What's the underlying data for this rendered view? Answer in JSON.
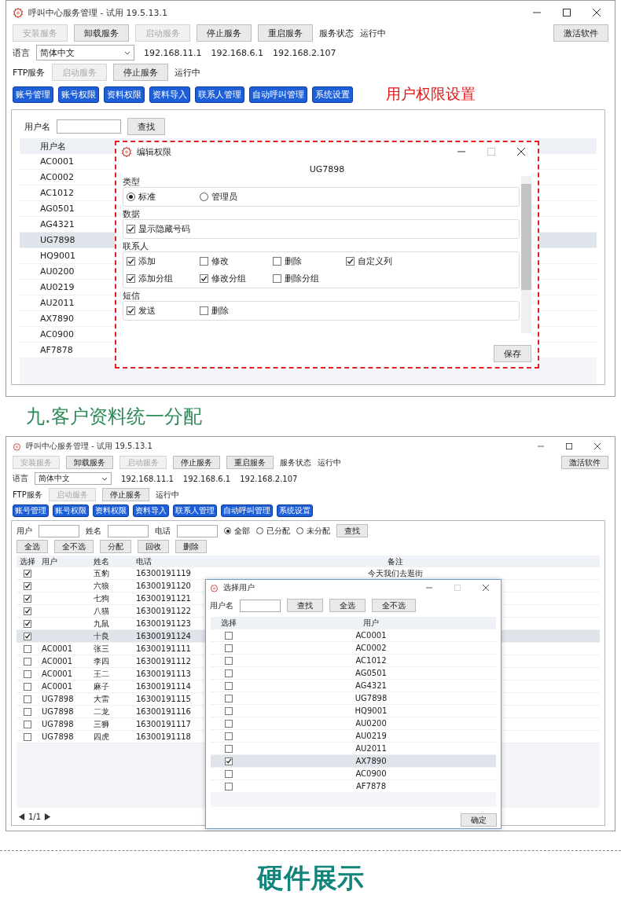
{
  "screen1": {
    "window": {
      "title": "呼叫中心服务管理 - 试用 19.5.13.1",
      "service_buttons": [
        {
          "label": "安装服务",
          "disabled": true
        },
        {
          "label": "卸载服务",
          "disabled": false
        },
        {
          "label": "启动服务",
          "disabled": true
        },
        {
          "label": "停止服务",
          "disabled": false
        },
        {
          "label": "重启服务",
          "disabled": false
        }
      ],
      "status_label": "服务状态",
      "status_value": "运行中",
      "activate_button": "激活软件",
      "language_label": "语言",
      "language_value": "简体中文",
      "ips": [
        "192.168.11.1",
        "192.168.6.1",
        "192.168.2.107"
      ],
      "ftp_label": "FTP服务",
      "ftp_buttons": [
        {
          "label": "启动服务",
          "disabled": true
        },
        {
          "label": "停止服务",
          "disabled": false
        }
      ],
      "ftp_status": "运行中",
      "nav_buttons": [
        "账号管理",
        "账号权限",
        "资料权限",
        "资料导入",
        "联系人管理",
        "自动呼叫管理",
        "系统设置"
      ]
    },
    "annotation": "用户权限设置",
    "search": {
      "label": "用户名",
      "button": "查找"
    },
    "table": {
      "columns": [
        "用户名"
      ],
      "rows": [
        {
          "user": "AC0001",
          "selected": false
        },
        {
          "user": "AC0002",
          "selected": false
        },
        {
          "user": "AC1012",
          "selected": false
        },
        {
          "user": "AG0501",
          "selected": false
        },
        {
          "user": "AG4321",
          "selected": false
        },
        {
          "user": "UG7898",
          "selected": true
        },
        {
          "user": "HQ9001",
          "selected": false
        },
        {
          "user": "AU0200",
          "selected": false
        },
        {
          "user": "AU0219",
          "selected": false
        },
        {
          "user": "AU2011",
          "selected": false
        },
        {
          "user": "AX7890",
          "selected": false
        },
        {
          "user": "AC0900",
          "selected": false
        },
        {
          "user": "AF7878",
          "selected": false
        }
      ]
    },
    "dialog": {
      "title": "编辑权限",
      "user": "UG7898",
      "groups": [
        {
          "title": "类型",
          "options": [
            {
              "kind": "radio",
              "label": "标准",
              "checked": true
            },
            {
              "kind": "radio",
              "label": "管理员",
              "checked": false
            }
          ]
        },
        {
          "title": "数据",
          "options": [
            {
              "kind": "checkbox",
              "label": "显示隐藏号码",
              "checked": true
            }
          ]
        },
        {
          "title": "联系人",
          "options": [
            {
              "kind": "checkbox",
              "label": "添加",
              "checked": true
            },
            {
              "kind": "checkbox",
              "label": "修改",
              "checked": false
            },
            {
              "kind": "checkbox",
              "label": "删除",
              "checked": false
            },
            {
              "kind": "checkbox",
              "label": "自定义列",
              "checked": true
            },
            {
              "kind": "checkbox",
              "label": "添加分组",
              "checked": true
            },
            {
              "kind": "checkbox",
              "label": "修改分组",
              "checked": true
            },
            {
              "kind": "checkbox",
              "label": "删除分组",
              "checked": false
            }
          ]
        },
        {
          "title": "短信",
          "options": [
            {
              "kind": "checkbox",
              "label": "发送",
              "checked": true
            },
            {
              "kind": "checkbox",
              "label": "删除",
              "checked": false
            }
          ]
        }
      ],
      "save_button": "保存"
    }
  },
  "section_heading": "九.客户资料统一分配",
  "screen2": {
    "window": {
      "title": "呼叫中心服务管理 - 试用 19.5.13.1",
      "service_buttons": [
        {
          "label": "安装服务",
          "disabled": true
        },
        {
          "label": "卸载服务",
          "disabled": false
        },
        {
          "label": "启动服务",
          "disabled": true
        },
        {
          "label": "停止服务",
          "disabled": false
        },
        {
          "label": "重启服务",
          "disabled": false
        }
      ],
      "status_label": "服务状态",
      "status_value": "运行中",
      "activate_button": "激活软件",
      "language_label": "语言",
      "language_value": "简体中文",
      "ips": [
        "192.168.11.1",
        "192.168.6.1",
        "192.168.2.107"
      ],
      "ftp_label": "FTP服务",
      "ftp_buttons": [
        {
          "label": "启动服务",
          "disabled": true
        },
        {
          "label": "停止服务",
          "disabled": false
        }
      ],
      "ftp_status": "运行中",
      "nav_buttons": [
        "账号管理",
        "账号权限",
        "资料权限",
        "资料导入",
        "联系人管理",
        "自动呼叫管理",
        "系统设置"
      ]
    },
    "filters": [
      {
        "label": "用户"
      },
      {
        "label": "姓名"
      },
      {
        "label": "电话"
      }
    ],
    "radios": [
      {
        "label": "全部",
        "checked": true
      },
      {
        "label": "已分配",
        "checked": false
      },
      {
        "label": "未分配",
        "checked": false
      }
    ],
    "search_button": "查找",
    "actions": [
      "全选",
      "全不选",
      "分配",
      "回收",
      "删除"
    ],
    "table": {
      "columns": [
        "选择",
        "用户",
        "姓名",
        "电话",
        "备注"
      ],
      "rows": [
        {
          "checked": true,
          "name": "五豹",
          "phone": "16300191119",
          "note": "今天我们去逛街",
          "selected": false
        },
        {
          "checked": true,
          "name": "六狼",
          "phone": "16300191120",
          "selected": false
        },
        {
          "checked": true,
          "name": "七狗",
          "phone": "16300191121",
          "selected": false
        },
        {
          "checked": true,
          "name": "八猫",
          "phone": "16300191122",
          "selected": false
        },
        {
          "checked": true,
          "name": "九鼠",
          "phone": "16300191123",
          "selected": false
        },
        {
          "checked": true,
          "name": "十良",
          "phone": "16300191124",
          "selected": true
        },
        {
          "checked": false,
          "user": "AC0001",
          "name": "张三",
          "phone": "16300191111",
          "selected": false
        },
        {
          "checked": false,
          "user": "AC0001",
          "name": "李四",
          "phone": "16300191112",
          "selected": false
        },
        {
          "checked": false,
          "user": "AC0001",
          "name": "王二",
          "phone": "16300191113",
          "selected": false
        },
        {
          "checked": false,
          "user": "AC0001",
          "name": "麻子",
          "phone": "16300191114",
          "selected": false
        },
        {
          "checked": false,
          "user": "UG7898",
          "name": "大雷",
          "phone": "16300191115",
          "selected": false
        },
        {
          "checked": false,
          "user": "UG7898",
          "name": "二龙",
          "phone": "16300191116",
          "selected": false
        },
        {
          "checked": false,
          "user": "UG7898",
          "name": "三狮",
          "phone": "16300191117",
          "selected": false
        },
        {
          "checked": false,
          "user": "UG7898",
          "name": "四虎",
          "phone": "16300191118",
          "selected": false
        }
      ]
    },
    "pager": "1/1",
    "dialog": {
      "title": "选择用户",
      "search_label": "用户名",
      "buttons": [
        "查找",
        "全选",
        "全不选"
      ],
      "columns": [
        "选择",
        "用户"
      ],
      "rows": [
        {
          "user": "AC0001",
          "checked": false,
          "selected": false
        },
        {
          "user": "AC0002",
          "checked": false,
          "selected": false
        },
        {
          "user": "AC1012",
          "checked": false,
          "selected": false
        },
        {
          "user": "AG0501",
          "checked": false,
          "selected": false
        },
        {
          "user": "AG4321",
          "checked": false,
          "selected": false
        },
        {
          "user": "UG7898",
          "checked": false,
          "selected": false
        },
        {
          "user": "HQ9001",
          "checked": false,
          "selected": false
        },
        {
          "user": "AU0200",
          "checked": false,
          "selected": false
        },
        {
          "user": "AU0219",
          "checked": false,
          "selected": false
        },
        {
          "user": "AU2011",
          "checked": false,
          "selected": false
        },
        {
          "user": "AX7890",
          "checked": true,
          "selected": true
        },
        {
          "user": "AC0900",
          "checked": false,
          "selected": false
        },
        {
          "user": "AF7878",
          "checked": false,
          "selected": false
        }
      ],
      "ok_button": "确定"
    }
  },
  "footer_heading": "硬件展示"
}
